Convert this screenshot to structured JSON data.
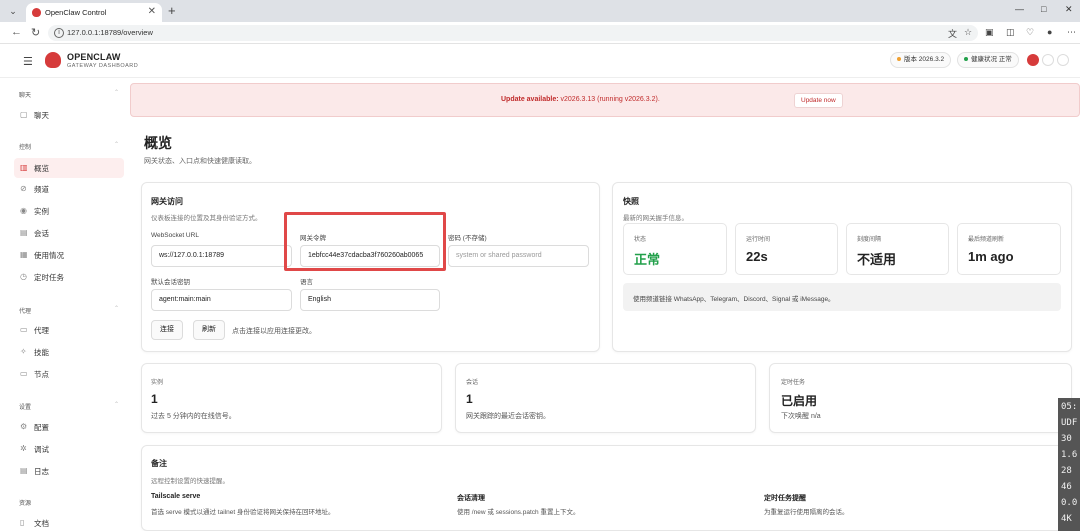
{
  "browser": {
    "tab_title": "OpenClaw Control",
    "url": "127.0.0.1:18789/overview",
    "tab_close": "✕",
    "new_tab": "+"
  },
  "header": {
    "brand": "OPENCLAW",
    "brand_sub": "GATEWAY DASHBOARD",
    "version": "版本 2026.3.2",
    "health": "健康状况 正常"
  },
  "sidebar": {
    "sections": [
      {
        "title": "聊天",
        "items": [
          "聊天"
        ]
      },
      {
        "title": "控制",
        "items": [
          "概览",
          "频道",
          "实例",
          "会话",
          "使用情况",
          "定时任务"
        ]
      },
      {
        "title": "代理",
        "items": [
          "代理",
          "技能",
          "节点"
        ]
      },
      {
        "title": "设置",
        "items": [
          "配置",
          "调试",
          "日志"
        ]
      },
      {
        "title": "资源",
        "items": [
          "文档"
        ]
      }
    ]
  },
  "banner": {
    "strong": "Update available:",
    "text": " v2026.3.13 (running v2026.3.2).",
    "button": "Update now"
  },
  "page": {
    "title": "概览",
    "subtitle": "网关状态、入口点和快速健康读取。"
  },
  "gateway": {
    "title": "网关访问",
    "subtitle": "仪表板连接的位置及其身份验证方式。",
    "ws_label": "WebSocket URL",
    "ws_value": "ws://127.0.0.1:18789",
    "token_label": "网关令牌",
    "token_value": "1ebfcc44e37cdacba3f760260ab0065",
    "password_label": "密码 (不存储)",
    "password_placeholder": "system or shared password",
    "session_label": "默认会话密钥",
    "session_value": "agent:main:main",
    "lang_label": "语言",
    "lang_value": "English",
    "connect": "连接",
    "refresh": "刷新",
    "hint": "点击连接以应用连接更改。"
  },
  "snapshot": {
    "title": "快照",
    "subtitle": "最新的网关握手信息。",
    "stats": [
      {
        "label": "状态",
        "value": "正常"
      },
      {
        "label": "运行时间",
        "value": "22s"
      },
      {
        "label": "刻度间隔",
        "value": "不适用"
      },
      {
        "label": "最后频道刷新",
        "value": "1m ago"
      }
    ],
    "note": "使用频道链接 WhatsApp、Telegram、Discord、Signal 或 iMessage。"
  },
  "mini_cards": [
    {
      "label": "实例",
      "value": "1",
      "sub": "过去 5 分钟内的在线信号。"
    },
    {
      "label": "会话",
      "value": "1",
      "sub": "网关跟踪的最近会话密钥。"
    },
    {
      "label": "定时任务",
      "value": "已启用",
      "sub": "下次唤醒 n/a"
    }
  ],
  "notes": {
    "title": "备注",
    "subtitle": "远程控制设置的快速提醒。",
    "items": [
      {
        "title": "Tailscale serve",
        "body": "首选 serve 模式以通过 tailnet 身份验证将网关保持在回环地址。"
      },
      {
        "title": "会话清理",
        "body": "使用 /new 或 sessions.patch 重置上下文。"
      },
      {
        "title": "定时任务提醒",
        "body": "为重复运行使用隔离的会话。"
      }
    ]
  },
  "overlay": [
    "05:",
    "UDF",
    "30",
    "1.6",
    "28",
    "46",
    "0.0",
    "4K"
  ],
  "colors": {
    "accent": "#d63b3b",
    "ok": "#22a04a",
    "banner_bg": "#fbe9e9"
  }
}
